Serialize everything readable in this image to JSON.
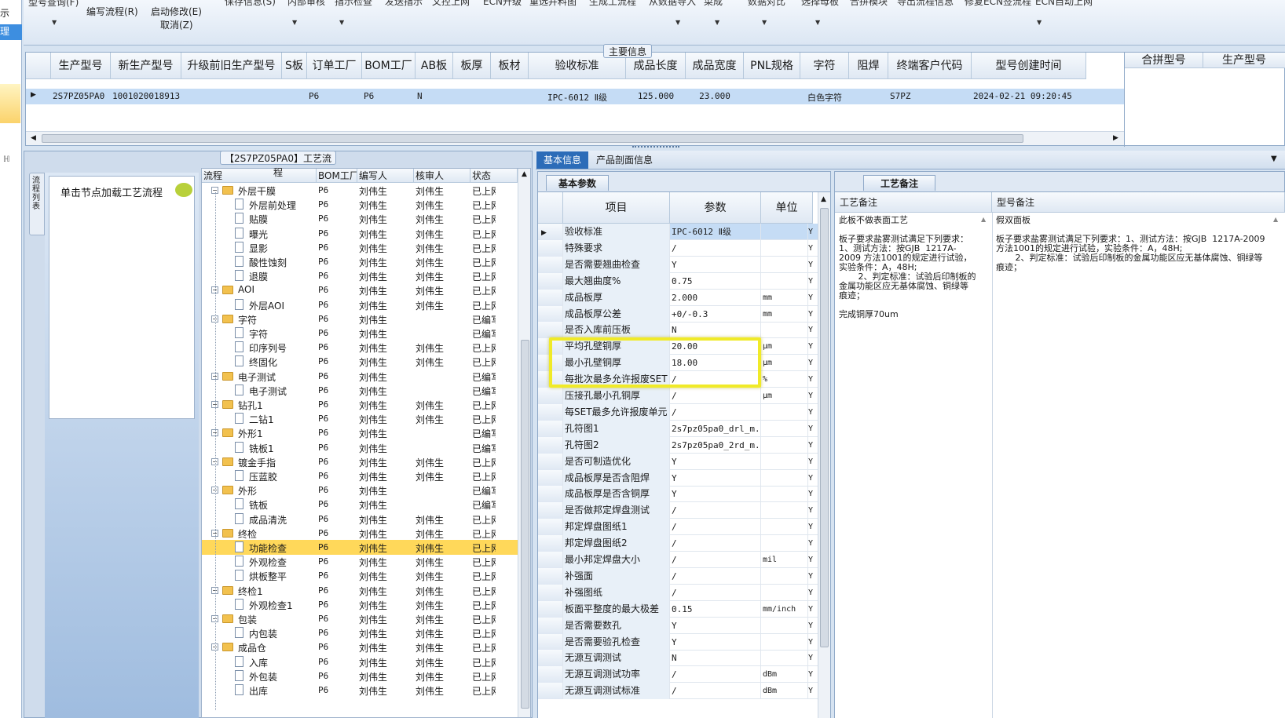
{
  "toolbar": {
    "top_cut_left": "型号查询(F)",
    "edit_flow": "编写流程(R)",
    "start_modify": "启动修改(E)",
    "cancel": "取消(Z)",
    "cut_labels": [
      "保存信息(S)",
      "内部审核",
      "指示检查",
      "发送指示",
      "文控上网",
      "ECN升级",
      "重选并料图",
      "生成工流程",
      "从数据导入",
      "菜成",
      "数据对比",
      "选择母板",
      "合拼模块",
      "导出流程信息",
      "修复ECN签流程",
      "ECN自动上网"
    ]
  },
  "left_strip": {
    "a": "示",
    "b": "理"
  },
  "main_info": {
    "title": "主要信息",
    "columns": [
      "生产型号",
      "新生产型号",
      "升级前旧生产型号",
      "S板",
      "订单工厂",
      "BOM工厂",
      "AB板",
      "板厚",
      "板材",
      "验收标准",
      "成品长度",
      "成品宽度",
      "PNL规格",
      "字符",
      "阻焊",
      "终端客户代码",
      "型号创建时间"
    ],
    "row": {
      "col0": "2S7PZ05PA0",
      "col1": "10010200189130",
      "col2": "",
      "col3": "",
      "col4": "P6",
      "col5": "P6",
      "col6": "N",
      "col7": "",
      "col8": "",
      "col9": "IPC-6012 Ⅱ级",
      "col10": "125.000",
      "col11": "23.000",
      "col12": "",
      "col13": "白色字符",
      "col14": "",
      "col15": "S7PZ",
      "col16": "2024-02-21 09:20:45"
    },
    "side_columns": [
      "合拼型号",
      "生产型号"
    ]
  },
  "process": {
    "title": "【2S7PZ05PA0】工艺流程",
    "vertical_tab": "流程列表",
    "load_text": "单击节点加载工艺流程",
    "columns": [
      "流程",
      "BOM工厂",
      "编写人",
      "核审人",
      "状态"
    ],
    "rows": [
      {
        "name": "外层干膜",
        "type": "folder",
        "bom": "P6",
        "writer": "刘伟生",
        "checker": "刘伟生",
        "status": "已上网"
      },
      {
        "name": "外层前处理",
        "type": "doc",
        "bom": "P6",
        "writer": "刘伟生",
        "checker": "刘伟生",
        "status": "已上网"
      },
      {
        "name": "贴膜",
        "type": "doc",
        "bom": "P6",
        "writer": "刘伟生",
        "checker": "刘伟生",
        "status": "已上网"
      },
      {
        "name": "曝光",
        "type": "doc",
        "bom": "P6",
        "writer": "刘伟生",
        "checker": "刘伟生",
        "status": "已上网"
      },
      {
        "name": "显影",
        "type": "doc",
        "bom": "P6",
        "writer": "刘伟生",
        "checker": "刘伟生",
        "status": "已上网"
      },
      {
        "name": "酸性蚀刻",
        "type": "doc",
        "bom": "P6",
        "writer": "刘伟生",
        "checker": "刘伟生",
        "status": "已上网"
      },
      {
        "name": "退膜",
        "type": "doc",
        "bom": "P6",
        "writer": "刘伟生",
        "checker": "刘伟生",
        "status": "已上网"
      },
      {
        "name": "AOI",
        "type": "folder",
        "bom": "P6",
        "writer": "刘伟生",
        "checker": "刘伟生",
        "status": "已上网"
      },
      {
        "name": "外层AOI",
        "type": "doc",
        "bom": "P6",
        "writer": "刘伟生",
        "checker": "刘伟生",
        "status": "已上网"
      },
      {
        "name": "字符",
        "type": "folder",
        "bom": "P6",
        "writer": "刘伟生",
        "checker": "",
        "status": "已编写"
      },
      {
        "name": "字符",
        "type": "doc",
        "bom": "P6",
        "writer": "刘伟生",
        "checker": "",
        "status": "已编写"
      },
      {
        "name": "印序列号",
        "type": "doc",
        "bom": "P6",
        "writer": "刘伟生",
        "checker": "刘伟生",
        "status": "已上网"
      },
      {
        "name": "终固化",
        "type": "doc",
        "bom": "P6",
        "writer": "刘伟生",
        "checker": "刘伟生",
        "status": "已上网"
      },
      {
        "name": "电子测试",
        "type": "folder",
        "bom": "P6",
        "writer": "刘伟生",
        "checker": "",
        "status": "已编写"
      },
      {
        "name": "电子测试",
        "type": "doc",
        "bom": "P6",
        "writer": "刘伟生",
        "checker": "",
        "status": "已编写"
      },
      {
        "name": "钻孔1",
        "type": "folder",
        "bom": "P6",
        "writer": "刘伟生",
        "checker": "刘伟生",
        "status": "已上网"
      },
      {
        "name": "二钻1",
        "type": "doc",
        "bom": "P6",
        "writer": "刘伟生",
        "checker": "刘伟生",
        "status": "已上网"
      },
      {
        "name": "外形1",
        "type": "folder",
        "bom": "P6",
        "writer": "刘伟生",
        "checker": "",
        "status": "已编写"
      },
      {
        "name": "铣板1",
        "type": "doc",
        "bom": "P6",
        "writer": "刘伟生",
        "checker": "",
        "status": "已编写"
      },
      {
        "name": "镀金手指",
        "type": "folder",
        "bom": "P6",
        "writer": "刘伟生",
        "checker": "刘伟生",
        "status": "已上网"
      },
      {
        "name": "压蓝胶",
        "type": "doc",
        "bom": "P6",
        "writer": "刘伟生",
        "checker": "刘伟生",
        "status": "已上网"
      },
      {
        "name": "外形",
        "type": "folder",
        "bom": "P6",
        "writer": "刘伟生",
        "checker": "",
        "status": "已编写"
      },
      {
        "name": "铣板",
        "type": "doc",
        "bom": "P6",
        "writer": "刘伟生",
        "checker": "",
        "status": "已编写"
      },
      {
        "name": "成品清洗",
        "type": "doc",
        "bom": "P6",
        "writer": "刘伟生",
        "checker": "刘伟生",
        "status": "已上网"
      },
      {
        "name": "终检",
        "type": "folder",
        "bom": "P6",
        "writer": "刘伟生",
        "checker": "刘伟生",
        "status": "已上网"
      },
      {
        "name": "功能检查",
        "type": "doc",
        "bom": "P6",
        "writer": "刘伟生",
        "checker": "刘伟生",
        "status": "已上网",
        "selected": true
      },
      {
        "name": "外观检查",
        "type": "doc",
        "bom": "P6",
        "writer": "刘伟生",
        "checker": "刘伟生",
        "status": "已上网"
      },
      {
        "name": "烘板整平",
        "type": "doc",
        "bom": "P6",
        "writer": "刘伟生",
        "checker": "刘伟生",
        "status": "已上网"
      },
      {
        "name": "终检1",
        "type": "folder",
        "bom": "P6",
        "writer": "刘伟生",
        "checker": "刘伟生",
        "status": "已上网"
      },
      {
        "name": "外观检查1",
        "type": "doc",
        "bom": "P6",
        "writer": "刘伟生",
        "checker": "刘伟生",
        "status": "已上网"
      },
      {
        "name": "包装",
        "type": "folder",
        "bom": "P6",
        "writer": "刘伟生",
        "checker": "刘伟生",
        "status": "已上网"
      },
      {
        "name": "内包装",
        "type": "doc",
        "bom": "P6",
        "writer": "刘伟生",
        "checker": "刘伟生",
        "status": "已上网"
      },
      {
        "name": "成品仓",
        "type": "folder",
        "bom": "P6",
        "writer": "刘伟生",
        "checker": "刘伟生",
        "status": "已上网"
      },
      {
        "name": "入库",
        "type": "doc",
        "bom": "P6",
        "writer": "刘伟生",
        "checker": "刘伟生",
        "status": "已上网"
      },
      {
        "name": "外包装",
        "type": "doc",
        "bom": "P6",
        "writer": "刘伟生",
        "checker": "刘伟生",
        "status": "已上网"
      },
      {
        "name": "出库",
        "type": "doc",
        "bom": "P6",
        "writer": "刘伟生",
        "checker": "刘伟生",
        "status": "已上网"
      }
    ]
  },
  "tabs": {
    "basic": "基本信息",
    "profile": "产品剖面信息"
  },
  "params": {
    "subtab": "基本参数",
    "columns": [
      "项目",
      "参数",
      "单位"
    ],
    "rows": [
      {
        "item": "验收标准",
        "value": "IPC-6012 Ⅱ级",
        "unit": "",
        "flag": "Y"
      },
      {
        "item": "特殊要求",
        "value": "/",
        "unit": "",
        "flag": "Y"
      },
      {
        "item": "是否需要翘曲检查",
        "value": "Y",
        "unit": "",
        "flag": "Y"
      },
      {
        "item": "最大翘曲度%",
        "value": "0.75",
        "unit": "",
        "flag": "Y"
      },
      {
        "item": "成品板厚",
        "value": "2.000",
        "unit": "mm",
        "flag": "Y"
      },
      {
        "item": "成品板厚公差",
        "value": "+0/-0.3",
        "unit": "mm",
        "flag": "Y"
      },
      {
        "item": "是否入库前压板",
        "value": "N",
        "unit": "",
        "flag": "Y"
      },
      {
        "item": "平均孔壁铜厚",
        "value": "20.00",
        "unit": "μm",
        "flag": "Y"
      },
      {
        "item": "最小孔壁铜厚",
        "value": "18.00",
        "unit": "μm",
        "flag": "Y"
      },
      {
        "item": "每批次最多允许报废SET",
        "value": "/",
        "unit": "%",
        "flag": "Y"
      },
      {
        "item": "压接孔最小孔铜厚",
        "value": "/",
        "unit": "μm",
        "flag": "Y"
      },
      {
        "item": "每SET最多允许报废单元",
        "value": "/",
        "unit": "",
        "flag": "Y"
      },
      {
        "item": "孔符图1",
        "value": "2s7pz05pa0_drl_m...",
        "unit": "",
        "flag": "Y"
      },
      {
        "item": "孔符图2",
        "value": "2s7pz05pa0_2rd_m...",
        "unit": "",
        "flag": "Y"
      },
      {
        "item": "是否可制造优化",
        "value": "Y",
        "unit": "",
        "flag": "Y"
      },
      {
        "item": "成品板厚是否含阻焊",
        "value": "Y",
        "unit": "",
        "flag": "Y"
      },
      {
        "item": "成品板厚是否含铜厚",
        "value": "Y",
        "unit": "",
        "flag": "Y"
      },
      {
        "item": "是否做邦定焊盘测试",
        "value": "/",
        "unit": "",
        "flag": "Y"
      },
      {
        "item": "邦定焊盘图纸1",
        "value": "/",
        "unit": "",
        "flag": "Y"
      },
      {
        "item": "邦定焊盘图纸2",
        "value": "/",
        "unit": "",
        "flag": "Y"
      },
      {
        "item": "最小邦定焊盘大小",
        "value": "/",
        "unit": "mil",
        "flag": "Y"
      },
      {
        "item": "补强面",
        "value": "/",
        "unit": "",
        "flag": "Y"
      },
      {
        "item": "补强图纸",
        "value": "/",
        "unit": "",
        "flag": "Y"
      },
      {
        "item": "板面平整度的最大极差",
        "value": "0.15",
        "unit": "mm/inch",
        "flag": "Y"
      },
      {
        "item": "是否需要数孔",
        "value": "Y",
        "unit": "",
        "flag": "Y"
      },
      {
        "item": "是否需要验孔检查",
        "value": "Y",
        "unit": "",
        "flag": "Y"
      },
      {
        "item": "无源互调测试",
        "value": "N",
        "unit": "",
        "flag": "Y"
      },
      {
        "item": "无源互调测试功率",
        "value": "/",
        "unit": "dBm",
        "flag": "Y"
      },
      {
        "item": "无源互调测试标准",
        "value": "/",
        "unit": "dBm",
        "flag": "Y"
      }
    ]
  },
  "remarks": {
    "title": "工艺备注",
    "col1": "工艺备注",
    "col2": "型号备注",
    "process_lines": [
      "此板不做表面工艺",
      "",
      "板子要求盐雾测试满足下列要求：1、测试方法：按GJB  1217A-2009 方法1001的规定进行试验，实验条件：A，48H;",
      "       2、判定标准：试验后印制板的金属功能区应无基体腐蚀、铜绿等痕迹；",
      "",
      "完成铜厚70um"
    ],
    "model_lines": [
      "假双面板",
      "",
      "板子要求盐雾测试满足下列要求：1、测试方法：按GJB  1217A-2009 方法1001的规定进行试验，实验条件：A，48H;",
      "       2、判定标准：试验后印制板的金属功能区应无基体腐蚀、铜绿等痕迹；"
    ]
  },
  "colors": {
    "highlight_box": "#f0ea28",
    "selected_row": "#ffd85a",
    "tab_active": "#2c6cb8"
  }
}
